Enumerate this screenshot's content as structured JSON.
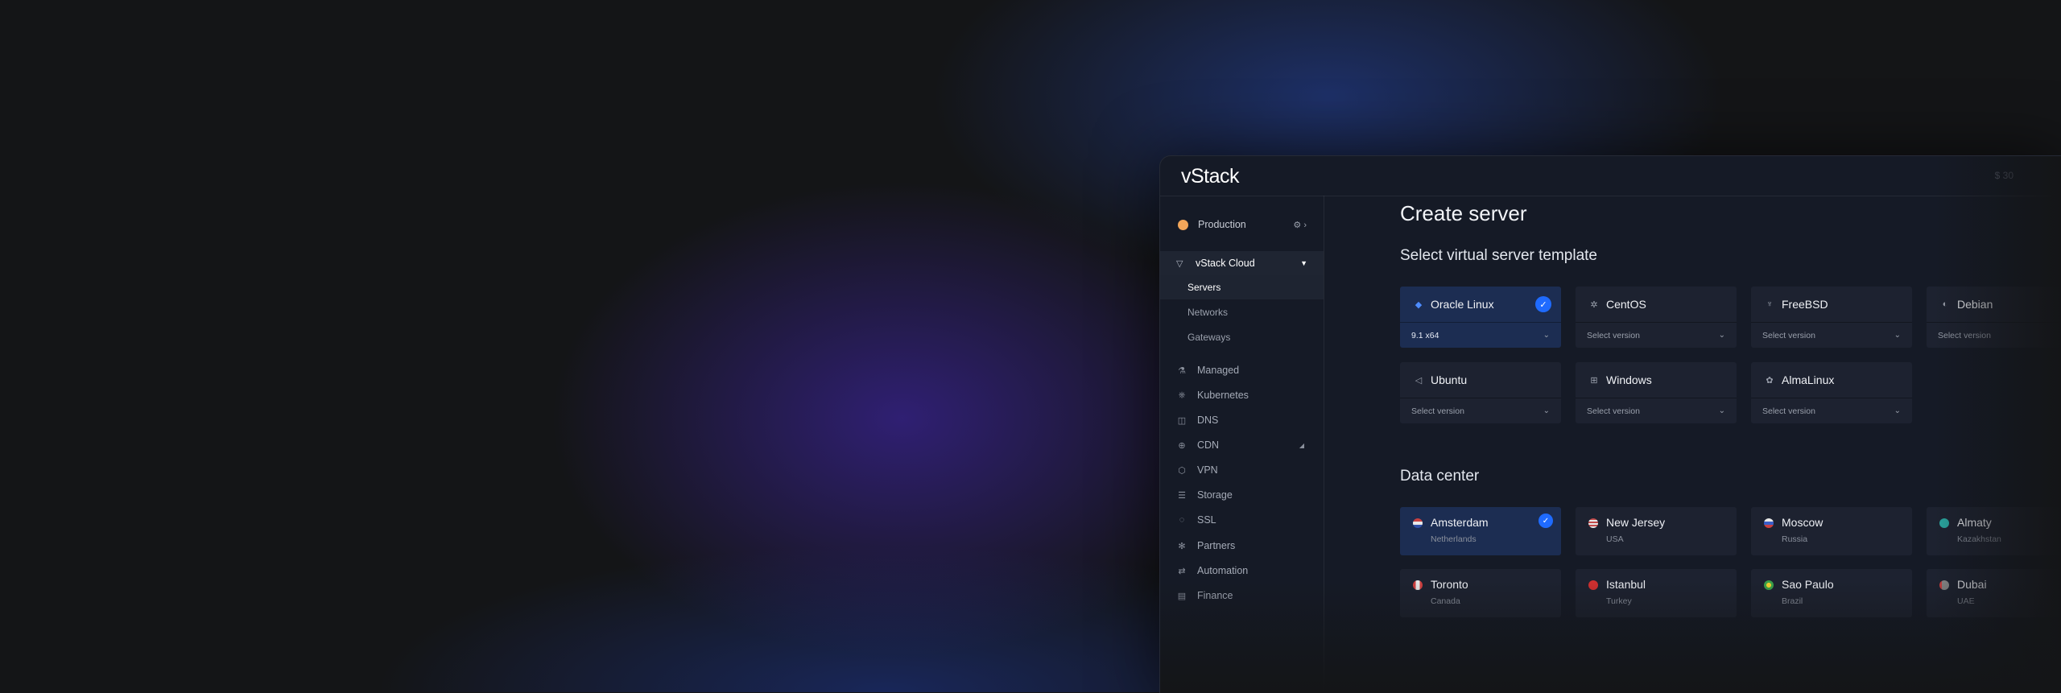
{
  "app": {
    "logo": "vStack",
    "top_right_text": "$ 30"
  },
  "sidebar": {
    "project": {
      "label": "Production",
      "icons": "⚙ ›",
      "dot_color": "#f2a65a"
    },
    "section": {
      "label": "vStack Cloud"
    },
    "sub_items": [
      {
        "label": "Servers",
        "active": true
      },
      {
        "label": "Networks",
        "active": false
      },
      {
        "label": "Gateways",
        "active": false
      }
    ],
    "items": [
      {
        "label": "Managed",
        "icon": "flask-icon"
      },
      {
        "label": "Kubernetes",
        "icon": "helm-icon"
      },
      {
        "label": "DNS",
        "icon": "dns-icon"
      },
      {
        "label": "CDN",
        "icon": "globe-icon"
      },
      {
        "label": "VPN",
        "icon": "shield-icon"
      },
      {
        "label": "Storage",
        "icon": "database-icon"
      },
      {
        "label": "SSL",
        "icon": "lock-shield-icon"
      },
      {
        "label": "Partners",
        "icon": "asterisk-icon"
      },
      {
        "label": "Automation",
        "icon": "arrows-icon"
      },
      {
        "label": "Finance",
        "icon": "document-icon"
      }
    ]
  },
  "main": {
    "title": "Create server",
    "template_section": "Select virtual server template",
    "templates": [
      {
        "name": "Oracle Linux",
        "version": "9.1 x64",
        "selected": true
      },
      {
        "name": "CentOS",
        "version": "Select version",
        "selected": false
      },
      {
        "name": "FreeBSD",
        "version": "Select version",
        "selected": false
      },
      {
        "name": "Debian",
        "version": "Select version",
        "selected": false
      },
      {
        "name": "Ubuntu",
        "version": "Select version",
        "selected": false
      },
      {
        "name": "Windows",
        "version": "Select version",
        "selected": false
      },
      {
        "name": "AlmaLinux",
        "version": "Select version",
        "selected": false
      }
    ],
    "datacenter_section": "Data center",
    "datacenters": [
      {
        "city": "Amsterdam",
        "country": "Netherlands",
        "selected": true,
        "flag_color": "#c8d0e0"
      },
      {
        "city": "New Jersey",
        "country": "USA",
        "selected": false,
        "flag_color": "#c24a4a"
      },
      {
        "city": "Moscow",
        "country": "Russia",
        "selected": false,
        "flag_color": "#3a5fc8"
      },
      {
        "city": "Almaty",
        "country": "Kazakhstan",
        "selected": false,
        "flag_color": "#2aa6a0"
      },
      {
        "city": "Toronto",
        "country": "Canada",
        "selected": false,
        "flag_color": "#d04040"
      },
      {
        "city": "Istanbul",
        "country": "Turkey",
        "selected": false,
        "flag_color": "#d03030"
      },
      {
        "city": "Sao Paulo",
        "country": "Brazil",
        "selected": false,
        "flag_color": "#3aa24a"
      },
      {
        "city": "Dubai",
        "country": "UAE",
        "selected": false,
        "flag_color": "#888888"
      }
    ]
  },
  "colors": {
    "accent": "#1f6bff",
    "selected_card": "#1c2d52",
    "card": "#1d2230",
    "window_bg": "#151a26"
  }
}
